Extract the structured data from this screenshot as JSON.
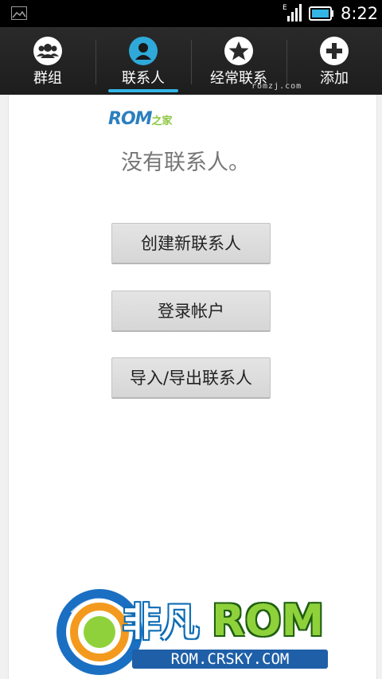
{
  "status_bar": {
    "clock": "8:22",
    "network_type": "E",
    "icons": [
      "image-notification-icon",
      "signal-icon",
      "battery-icon"
    ]
  },
  "tabs": [
    {
      "label": "群组",
      "icon": "group-icon",
      "selected": false
    },
    {
      "label": "联系人",
      "icon": "person-icon",
      "selected": true
    },
    {
      "label": "经常联系",
      "icon": "star-icon",
      "selected": false
    },
    {
      "label": "添加",
      "icon": "plus-icon",
      "selected": false
    }
  ],
  "watermark_small": "romzj.com",
  "content": {
    "logo_text": "ROM",
    "logo_subtext": "之家",
    "empty_title": "没有联系人。",
    "buttons": {
      "create_contact": "创建新联系人",
      "sign_in_account": "登录帐户",
      "import_export": "导入/导出联系人"
    }
  },
  "watermark_logo": {
    "cn_text": "非凡",
    "rom_text": "ROM",
    "url": "ROM.CRSKY.COM"
  },
  "colors": {
    "accent": "#33b5e5",
    "tab_background": "#222222",
    "status_bar": "#000000"
  }
}
